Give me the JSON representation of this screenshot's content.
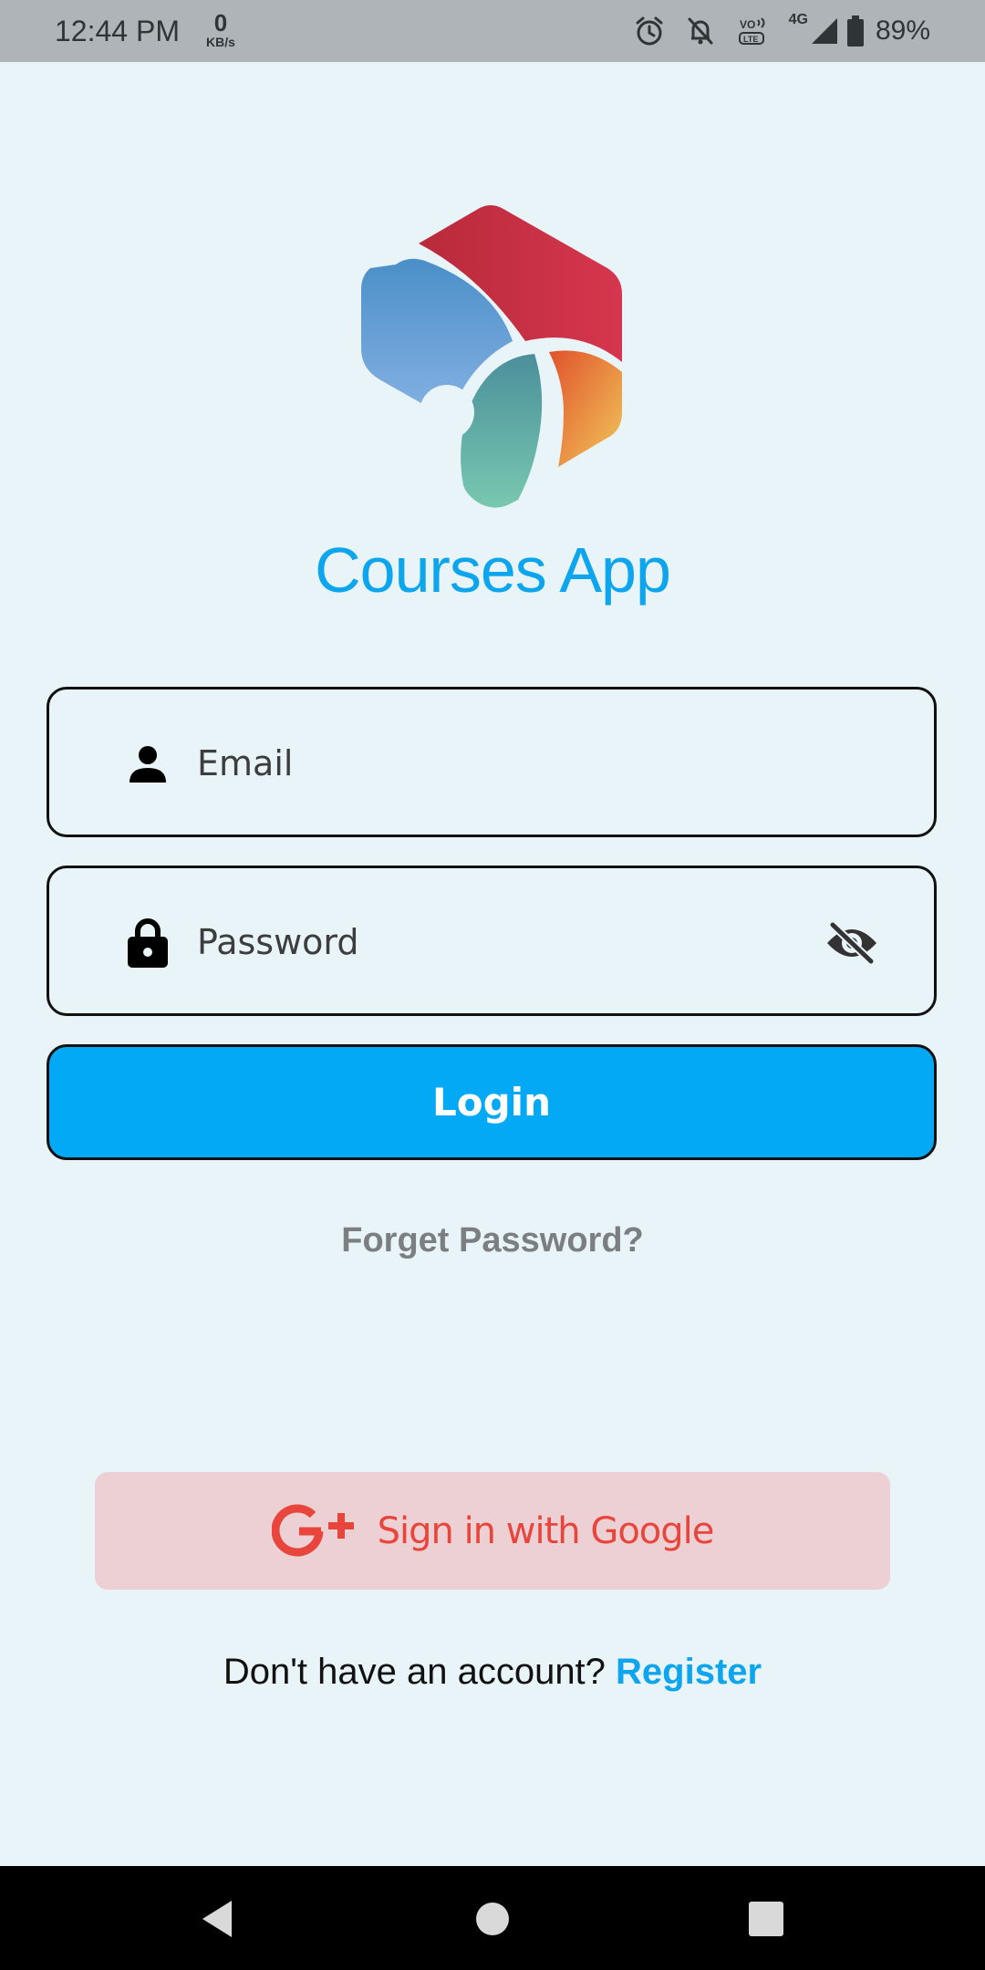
{
  "status_bar": {
    "time": "12:44 PM",
    "speed_value": "0",
    "speed_unit": "KB/s",
    "network": "4G",
    "battery": "89%",
    "icons": [
      "alarm-icon",
      "bell-off-icon",
      "volte-icon",
      "signal-icon",
      "battery-icon"
    ]
  },
  "app": {
    "title": "Courses App",
    "logo": "hexagon-logo"
  },
  "form": {
    "email_placeholder": "Email",
    "email_icon": "person-icon",
    "password_placeholder": "Password",
    "password_icon": "lock-icon",
    "visibility_icon": "eye-off-icon",
    "login_label": "Login",
    "forget_label": "Forget Password?"
  },
  "google": {
    "label": "Sign in with Google",
    "icon": "google-plus-icon"
  },
  "register": {
    "prompt": "Don't have an account?",
    "link": "Register"
  },
  "colors": {
    "background": "#e9f4f8",
    "accent": "#03a9f4",
    "title": "#0da5ee",
    "google_bg": "#ecd0d3",
    "google_text": "#e8453c"
  },
  "nav": {
    "icons": [
      "back-icon",
      "home-icon",
      "recents-icon"
    ]
  }
}
